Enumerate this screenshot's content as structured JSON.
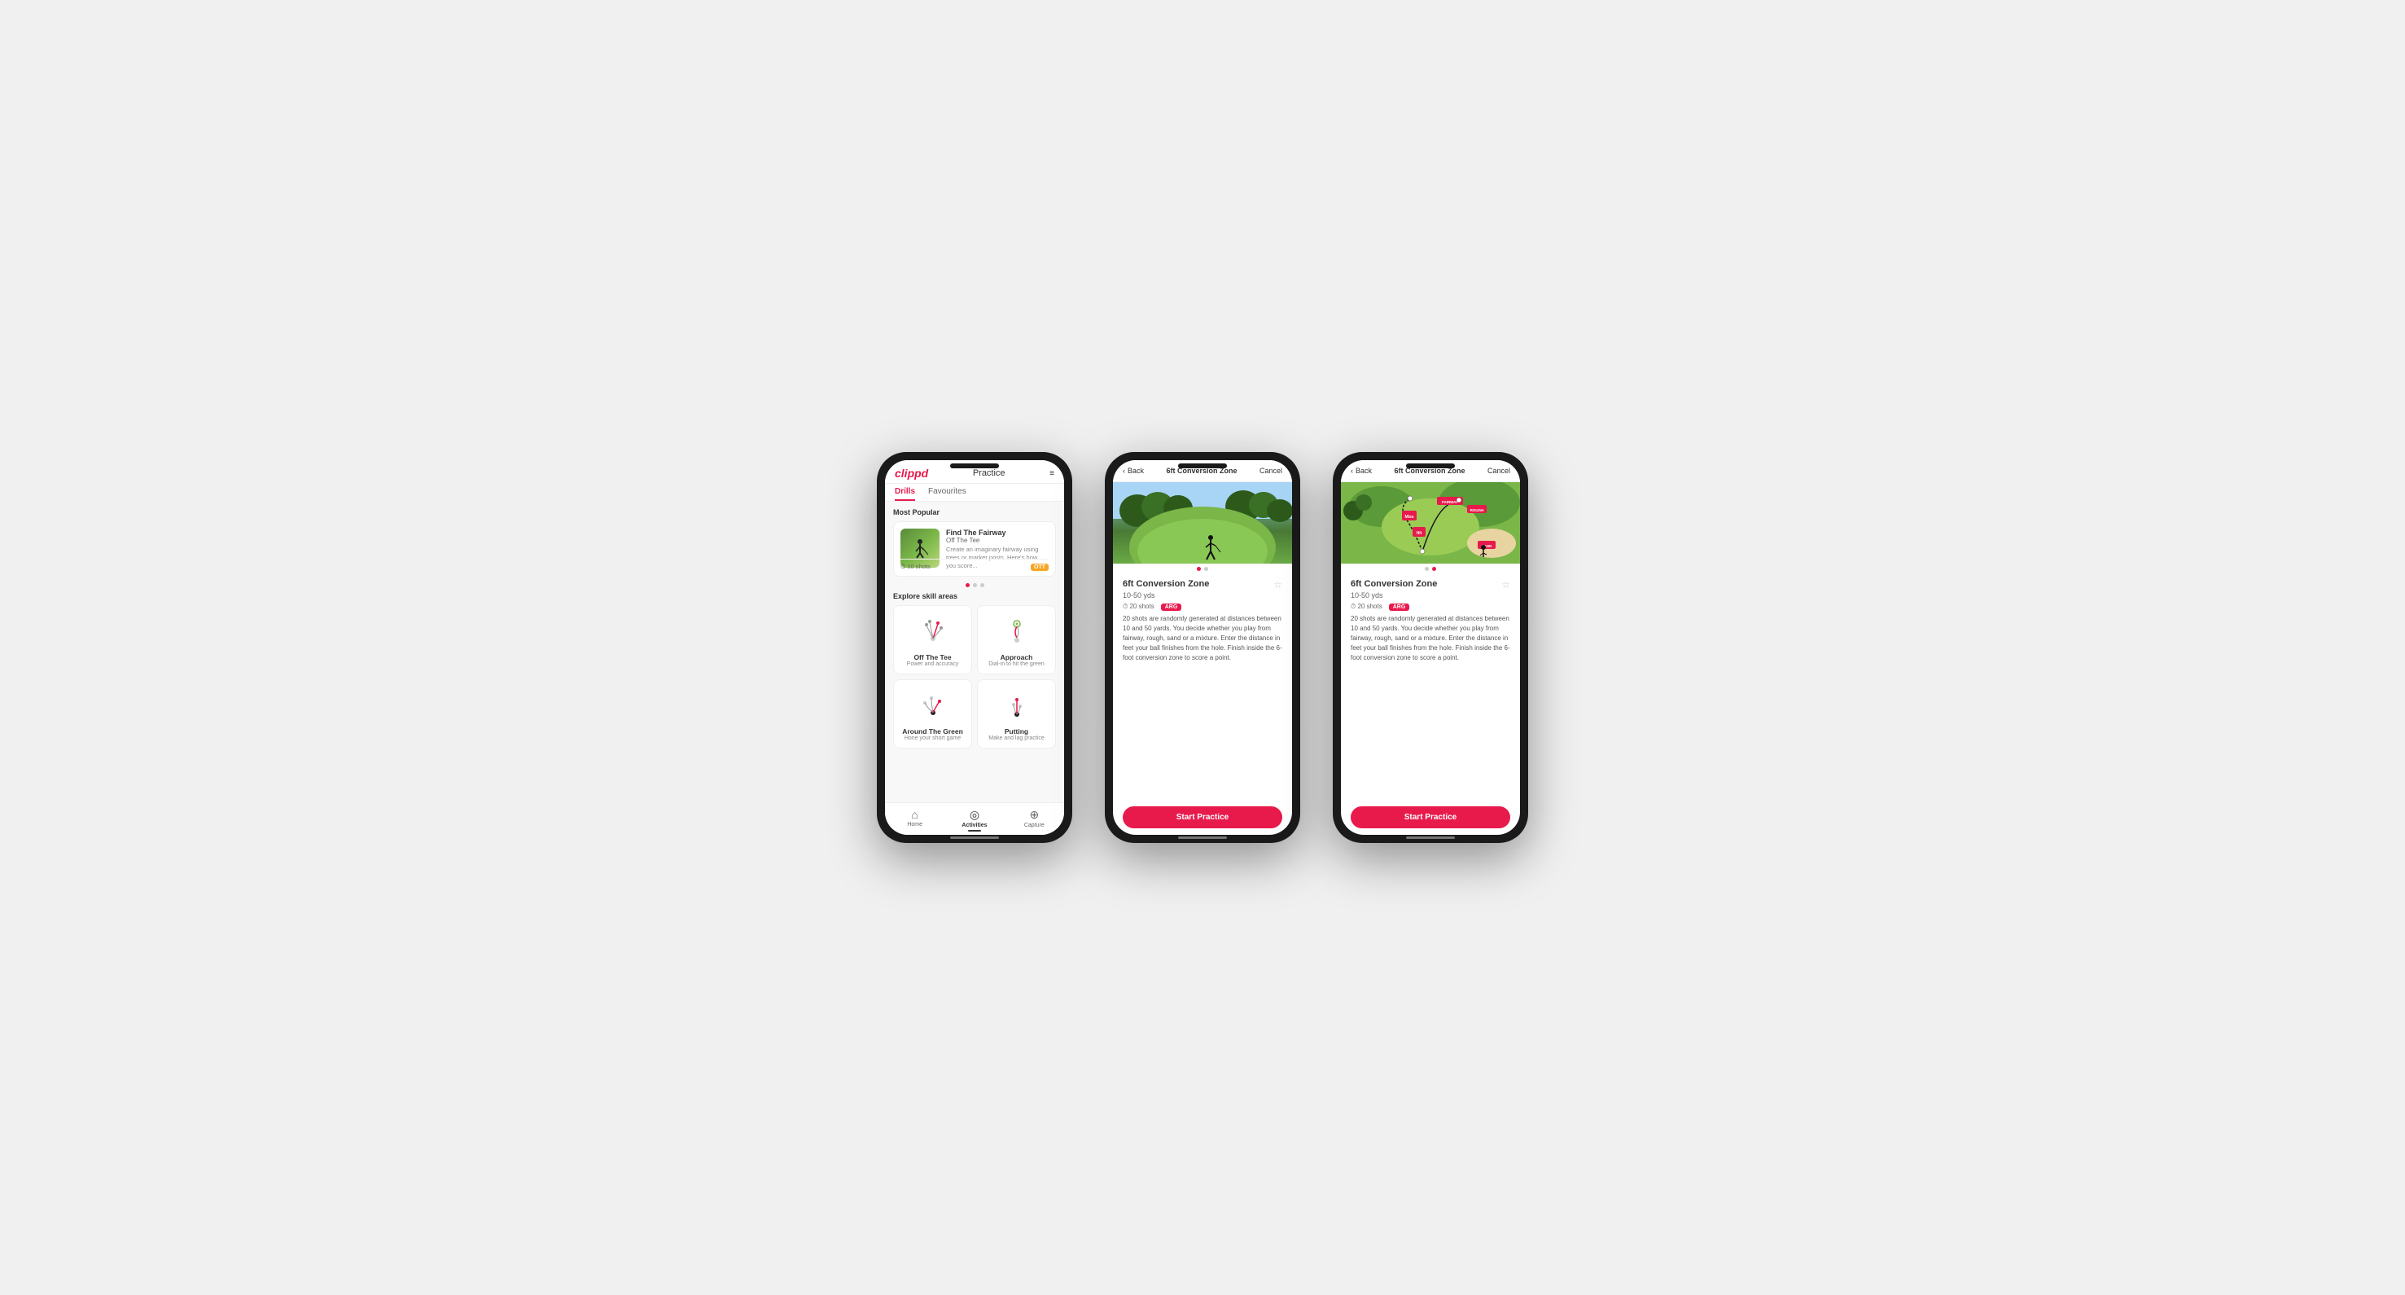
{
  "app": {
    "logo": "clippd",
    "header_title": "Practice",
    "menu_icon": "≡"
  },
  "phone1": {
    "tabs": [
      {
        "label": "Drills",
        "active": true
      },
      {
        "label": "Favourites",
        "active": false
      }
    ],
    "most_popular_label": "Most Popular",
    "featured_drill": {
      "title": "Find The Fairway",
      "subtitle": "Off The Tee",
      "description": "Create an imaginary fairway using trees or marker posts. Here's how you score...",
      "shots": "10 shots",
      "badge": "OTT"
    },
    "explore_label": "Explore skill areas",
    "skill_areas": [
      {
        "name": "Off The Tee",
        "desc": "Power and accuracy"
      },
      {
        "name": "Approach",
        "desc": "Dial-in to hit the green"
      },
      {
        "name": "Around The Green",
        "desc": "Hone your short game"
      },
      {
        "name": "Putting",
        "desc": "Make and lag practice"
      }
    ],
    "nav_items": [
      {
        "icon": "⌂",
        "label": "Home",
        "active": false
      },
      {
        "icon": "◎",
        "label": "Activities",
        "active": true
      },
      {
        "icon": "⊕",
        "label": "Capture",
        "active": false
      }
    ]
  },
  "phone2": {
    "back_label": "Back",
    "nav_title": "6ft Conversion Zone",
    "cancel_label": "Cancel",
    "drill": {
      "title": "6ft Conversion Zone",
      "distance": "10-50 yds",
      "shots": "20 shots",
      "badge": "ARG",
      "description": "20 shots are randomly generated at distances between 10 and 50 yards. You decide whether you play from fairway, rough, sand or a mixture. Enter the distance in feet your ball finishes from the hole. Finish inside the 6-foot conversion zone to score a point."
    },
    "start_practice_label": "Start Practice"
  },
  "phone3": {
    "back_label": "Back",
    "nav_title": "6ft Conversion Zone",
    "cancel_label": "Cancel",
    "drill": {
      "title": "6ft Conversion Zone",
      "distance": "10-50 yds",
      "shots": "20 shots",
      "badge": "ARG",
      "description": "20 shots are randomly generated at distances between 10 and 50 yards. You decide whether you play from fairway, rough, sand or a mixture. Enter the distance in feet your ball finishes from the hole. Finish inside the 6-foot conversion zone to score a point."
    },
    "start_practice_label": "Start Practice",
    "map_labels": [
      "FAIRWAY",
      "ROUGH",
      "Miss",
      "Hit",
      "SAND"
    ]
  },
  "colors": {
    "brand_red": "#e8194b",
    "ott_orange": "#f5a623",
    "arg_red": "#e8194b",
    "text_dark": "#333333",
    "text_light": "#888888",
    "green_fairway": "#7ab648"
  }
}
